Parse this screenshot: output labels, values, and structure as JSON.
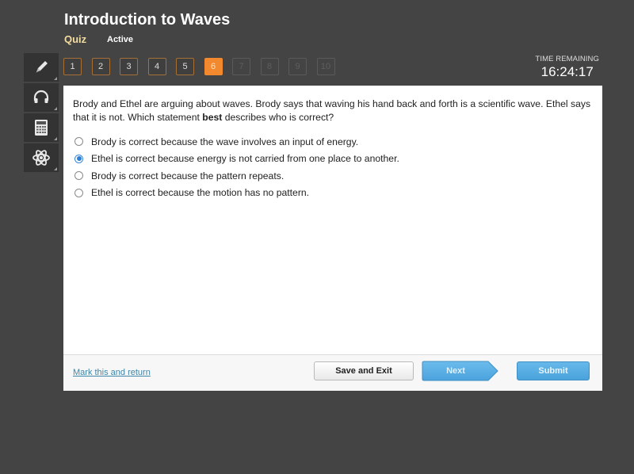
{
  "header": {
    "title": "Introduction to Waves",
    "type_label": "Quiz",
    "status_label": "Active"
  },
  "toolbar": {
    "tools": [
      {
        "name": "pencil-icon"
      },
      {
        "name": "headphones-icon"
      },
      {
        "name": "calculator-icon"
      },
      {
        "name": "atom-icon"
      }
    ]
  },
  "question_nav": {
    "current": 6,
    "items": [
      {
        "label": "1",
        "state": "answered"
      },
      {
        "label": "2",
        "state": "answered"
      },
      {
        "label": "3",
        "state": "answered"
      },
      {
        "label": "4",
        "state": "answered"
      },
      {
        "label": "5",
        "state": "answered"
      },
      {
        "label": "6",
        "state": "current"
      },
      {
        "label": "7",
        "state": "disabled"
      },
      {
        "label": "8",
        "state": "disabled"
      },
      {
        "label": "9",
        "state": "disabled"
      },
      {
        "label": "10",
        "state": "disabled"
      }
    ]
  },
  "timer": {
    "label": "TIME REMAINING",
    "value": "16:24:17"
  },
  "question": {
    "text_before": "Brody and Ethel are arguing about waves. Brody says that waving his hand back and forth is a scientific wave. Ethel says that it is not. Which statement ",
    "text_bold": "best",
    "text_after": " describes who is correct?",
    "options": [
      {
        "label": "Brody is correct because the wave involves an input of energy.",
        "selected": false
      },
      {
        "label": "Ethel is correct because energy is not carried from one place to another.",
        "selected": true
      },
      {
        "label": "Brody is correct because the pattern repeats.",
        "selected": false
      },
      {
        "label": "Ethel is correct because the motion has no pattern.",
        "selected": false
      }
    ]
  },
  "footer": {
    "mark_link": "Mark this and return",
    "save_label": "Save and Exit",
    "next_label": "Next",
    "submit_label": "Submit"
  },
  "colors": {
    "background": "#444444",
    "accent_orange": "#f3892e",
    "button_blue": "#55aee2",
    "link": "#3d86a8"
  }
}
